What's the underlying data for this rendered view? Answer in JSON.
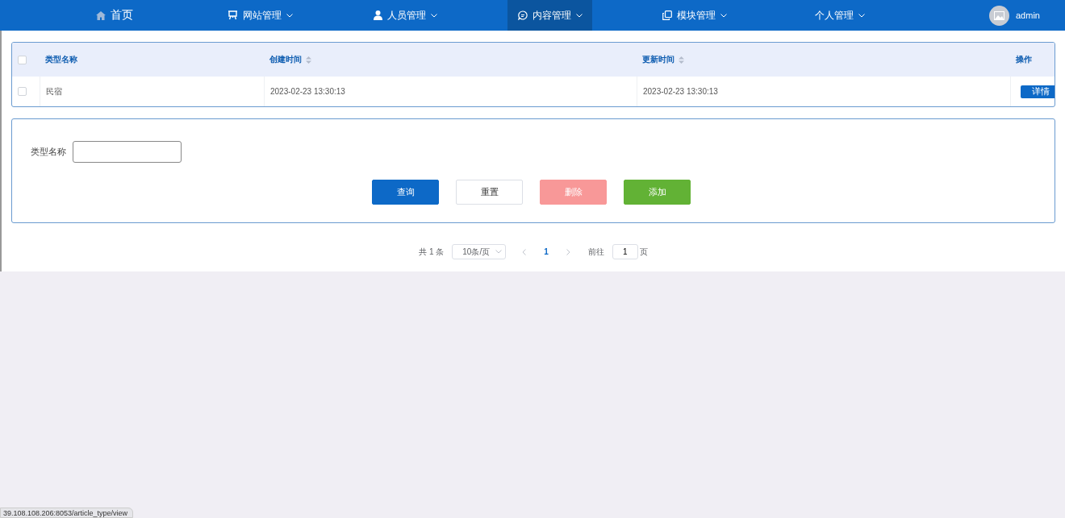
{
  "nav": {
    "items": [
      {
        "label": "首页",
        "selected": false,
        "dropdown": false
      },
      {
        "label": "网站管理",
        "selected": false,
        "dropdown": true
      },
      {
        "label": "人员管理",
        "selected": false,
        "dropdown": true
      },
      {
        "label": "内容管理",
        "selected": true,
        "dropdown": true
      },
      {
        "label": "模块管理",
        "selected": false,
        "dropdown": true
      },
      {
        "label": "个人管理",
        "selected": false,
        "dropdown": true
      }
    ],
    "user": "admin"
  },
  "table": {
    "columns": [
      {
        "label": "类型名称",
        "sortable": false
      },
      {
        "label": "创建时间",
        "sortable": true
      },
      {
        "label": "更新时间",
        "sortable": true
      },
      {
        "label": "操作",
        "sortable": false
      }
    ],
    "all_checked": false,
    "rows": [
      {
        "checked": false,
        "cells": [
          "民宿",
          "2023-02-23 13:30:13",
          "2023-02-23 13:30:13"
        ],
        "action": "详情"
      }
    ]
  },
  "search": {
    "label": "类型名称",
    "buttons": [
      {
        "label": "查询",
        "kind": "primary"
      },
      {
        "label": "重置",
        "kind": "plain"
      },
      {
        "label": "删除",
        "kind": "danger"
      },
      {
        "label": "添加",
        "kind": "success"
      }
    ]
  },
  "pagination": {
    "total": "共 1 条",
    "page_size": "10条/页",
    "pages": [
      {
        "label": "1",
        "selected": true
      }
    ],
    "goto_label": "前往",
    "goto_value": "1",
    "goto_suffix": "页"
  },
  "status_bar": "39.108.108.206:8053/article_type/view"
}
